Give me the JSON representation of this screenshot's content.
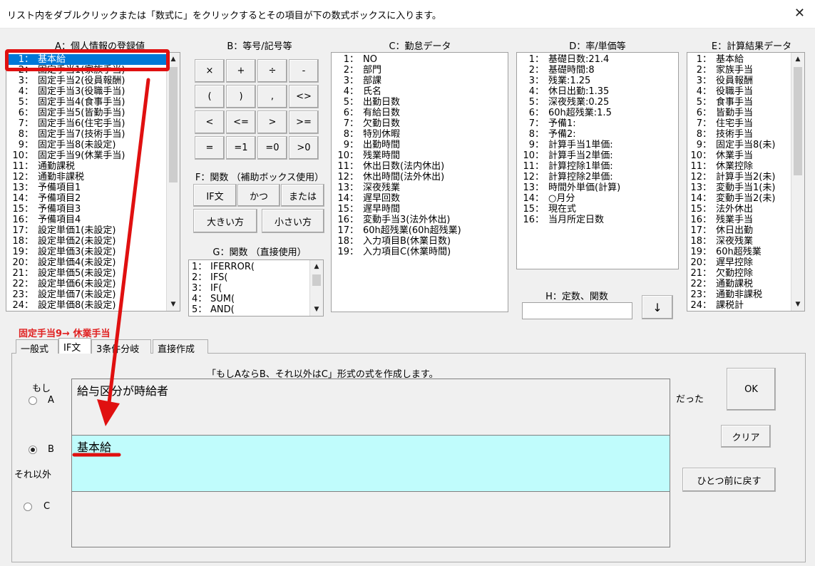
{
  "window": {
    "title": "リスト内をダブルクリックまたは「数式に」をクリックするとその項目が下の数式ボックスに入ります。",
    "close_glyph": "✕"
  },
  "groups": {
    "a": "A：個人情報の登録値",
    "b": "B：等号/記号等",
    "c": "C：勤怠データ",
    "d": "D：率/単価等",
    "e": "E：計算結果データ",
    "f": "F：関数 （補助ボックス使用）",
    "g": "G：関数 （直接使用）",
    "h": "H：定数、関数"
  },
  "list_a": [
    {
      "n": "1：",
      "t": "基本給"
    },
    {
      "n": "2：",
      "t": "固定手当1(家族手当)"
    },
    {
      "n": "3：",
      "t": "固定手当2(役員報酬)"
    },
    {
      "n": "4：",
      "t": "固定手当3(役職手当)"
    },
    {
      "n": "5：",
      "t": "固定手当4(食事手当)"
    },
    {
      "n": "6：",
      "t": "固定手当5(皆勤手当)"
    },
    {
      "n": "7：",
      "t": "固定手当6(住宅手当)"
    },
    {
      "n": "8：",
      "t": "固定手当7(技術手当)"
    },
    {
      "n": "9：",
      "t": "固定手当8(未設定)"
    },
    {
      "n": "10：",
      "t": "固定手当9(休業手当)"
    },
    {
      "n": "11：",
      "t": "通勤課税"
    },
    {
      "n": "12：",
      "t": "通勤非課税"
    },
    {
      "n": "13：",
      "t": "予備項目1"
    },
    {
      "n": "14：",
      "t": "予備項目2"
    },
    {
      "n": "15：",
      "t": "予備項目3"
    },
    {
      "n": "16：",
      "t": "予備項目4"
    },
    {
      "n": "17：",
      "t": "設定単価1(未設定)"
    },
    {
      "n": "18：",
      "t": "設定単価2(未設定)"
    },
    {
      "n": "19：",
      "t": "設定単価3(未設定)"
    },
    {
      "n": "20：",
      "t": "設定単価4(未設定)"
    },
    {
      "n": "21：",
      "t": "設定単価5(未設定)"
    },
    {
      "n": "22：",
      "t": "設定単価6(未設定)"
    },
    {
      "n": "23：",
      "t": "設定単価7(未設定)"
    },
    {
      "n": "24：",
      "t": "設定単価8(未設定)"
    }
  ],
  "symbols": [
    "×",
    "+",
    "÷",
    "-",
    "(",
    ")",
    ",",
    "<>",
    "<",
    "<=",
    ">",
    ">=",
    "=",
    "=1",
    "=0",
    ">0"
  ],
  "func_buttons": {
    "if": "IF文",
    "and": "かつ",
    "or": "または",
    "max": "大きい方",
    "min": "小さい方"
  },
  "list_g": [
    {
      "n": "1：",
      "t": "IFERROR("
    },
    {
      "n": "2：",
      "t": "IFS("
    },
    {
      "n": "3：",
      "t": "IF("
    },
    {
      "n": "4：",
      "t": "SUM("
    },
    {
      "n": "5：",
      "t": "AND("
    }
  ],
  "list_c": [
    {
      "n": "1：",
      "t": "NO"
    },
    {
      "n": "2：",
      "t": "部門"
    },
    {
      "n": "3：",
      "t": "部課"
    },
    {
      "n": "4：",
      "t": "氏名"
    },
    {
      "n": "5：",
      "t": "出勤日数"
    },
    {
      "n": "6：",
      "t": "有給日数"
    },
    {
      "n": "7：",
      "t": "欠勤日数"
    },
    {
      "n": "8：",
      "t": "特別休暇"
    },
    {
      "n": "9：",
      "t": "出勤時間"
    },
    {
      "n": "10：",
      "t": "残業時間"
    },
    {
      "n": "11：",
      "t": "休出日数(法内休出)"
    },
    {
      "n": "12：",
      "t": "休出時間(法外休出)"
    },
    {
      "n": "13：",
      "t": "深夜残業"
    },
    {
      "n": "14：",
      "t": "遅早回数"
    },
    {
      "n": "15：",
      "t": "遅早時間"
    },
    {
      "n": "16：",
      "t": "変動手当3(法外休出)"
    },
    {
      "n": "17：",
      "t": "60h超残業(60h超残業)"
    },
    {
      "n": "18：",
      "t": "入力項目B(休業日数)"
    },
    {
      "n": "19：",
      "t": "入力項目C(休業時間)"
    }
  ],
  "list_d": [
    {
      "n": "1：",
      "t": "基礎日数:21.4"
    },
    {
      "n": "2：",
      "t": "基礎時間:8"
    },
    {
      "n": "3：",
      "t": "残業:1.25"
    },
    {
      "n": "4：",
      "t": "休日出勤:1.35"
    },
    {
      "n": "5：",
      "t": "深夜残業:0.25"
    },
    {
      "n": "6：",
      "t": "60h超残業:1.5"
    },
    {
      "n": "7：",
      "t": "予備1:"
    },
    {
      "n": "8：",
      "t": "予備2:"
    },
    {
      "n": "9：",
      "t": "計算手当1単価:"
    },
    {
      "n": "10：",
      "t": "計算手当2単価:"
    },
    {
      "n": "11：",
      "t": "計算控除1単価:"
    },
    {
      "n": "12：",
      "t": "計算控除2単価:"
    },
    {
      "n": "13：",
      "t": "時間外単価(計算)"
    },
    {
      "n": "14：",
      "t": "○月分"
    },
    {
      "n": "15：",
      "t": "現在式"
    },
    {
      "n": "16：",
      "t": "当月所定日数"
    }
  ],
  "list_e": [
    {
      "n": "1：",
      "t": "基本給"
    },
    {
      "n": "2：",
      "t": "家族手当"
    },
    {
      "n": "3：",
      "t": "役員報酬"
    },
    {
      "n": "4：",
      "t": "役職手当"
    },
    {
      "n": "5：",
      "t": "食事手当"
    },
    {
      "n": "6：",
      "t": "皆勤手当"
    },
    {
      "n": "7：",
      "t": "住宅手当"
    },
    {
      "n": "8：",
      "t": "技術手当"
    },
    {
      "n": "9：",
      "t": "固定手当8(未)"
    },
    {
      "n": "10：",
      "t": "休業手当"
    },
    {
      "n": "11：",
      "t": "休業控除"
    },
    {
      "n": "12：",
      "t": "計算手当2(未)"
    },
    {
      "n": "13：",
      "t": "変動手当1(未)"
    },
    {
      "n": "14：",
      "t": "変動手当2(未)"
    },
    {
      "n": "15：",
      "t": "法外休出"
    },
    {
      "n": "16：",
      "t": "残業手当"
    },
    {
      "n": "17：",
      "t": "休日出勤"
    },
    {
      "n": "18：",
      "t": "深夜残業"
    },
    {
      "n": "19：",
      "t": "60h超残業"
    },
    {
      "n": "20：",
      "t": "遅早控除"
    },
    {
      "n": "21：",
      "t": "欠勤控除"
    },
    {
      "n": "22：",
      "t": "通勤課税"
    },
    {
      "n": "23：",
      "t": "通勤非課税"
    },
    {
      "n": "24：",
      "t": "課税計"
    }
  ],
  "constant": {
    "value": "",
    "arrow": "↓"
  },
  "annotation": {
    "text": "固定手当9→ 休業手当",
    "color": "#e02020"
  },
  "tabs": [
    "一般式",
    "IF文",
    "3条件分岐",
    "直接作成"
  ],
  "active_tab": "IF文",
  "panel": {
    "caption": "「もしAならB、それ以外はC」形式の式を作成します。",
    "if_label": "もし",
    "a_label": "A",
    "b_label": "B",
    "c_label": "C",
    "else_label": "それ以外",
    "then_label": "だった",
    "a_text": "給与区分が時給者",
    "b_text": "基本給",
    "c_text": "",
    "selected_option": "B",
    "ok": "OK",
    "clear": "クリア",
    "undo": "ひとつ前に戻す"
  }
}
